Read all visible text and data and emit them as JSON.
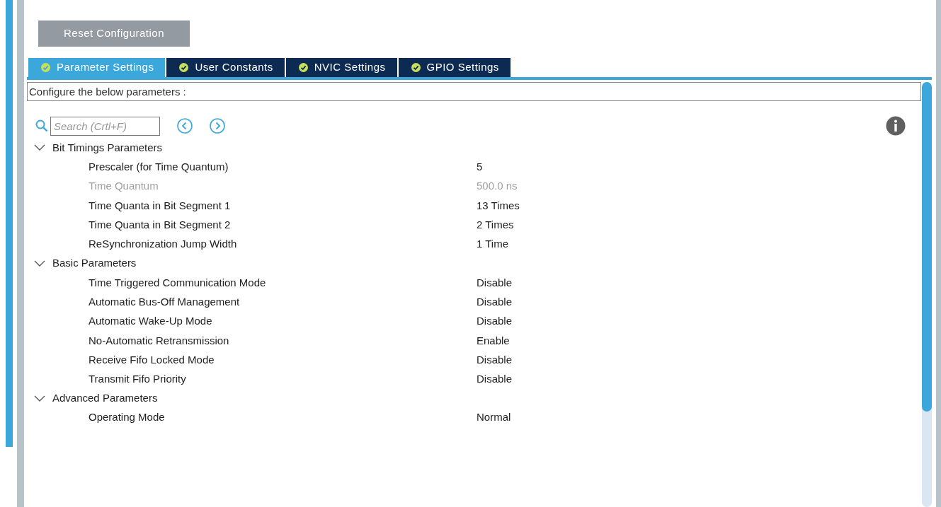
{
  "reset_button": "Reset Configuration",
  "tabs": [
    {
      "label": "Parameter Settings",
      "selected": true
    },
    {
      "label": "User Constants",
      "selected": false
    },
    {
      "label": "NVIC Settings",
      "selected": false
    },
    {
      "label": "GPIO Settings",
      "selected": false
    }
  ],
  "description": "Configure the below parameters :",
  "search": {
    "placeholder": "Search (Crtl+F)"
  },
  "groups": [
    {
      "title": "Bit Timings Parameters",
      "expanded": true,
      "params": [
        {
          "name": "Prescaler (for Time Quantum)",
          "value": "5",
          "disabled": false
        },
        {
          "name": "Time Quantum",
          "value": "500.0 ns",
          "disabled": true
        },
        {
          "name": "Time Quanta in Bit Segment 1",
          "value": "13 Times",
          "disabled": false
        },
        {
          "name": "Time Quanta in Bit Segment 2",
          "value": "2 Times",
          "disabled": false
        },
        {
          "name": "ReSynchronization Jump Width",
          "value": "1 Time",
          "disabled": false
        }
      ]
    },
    {
      "title": "Basic Parameters",
      "expanded": true,
      "params": [
        {
          "name": "Time Triggered Communication Mode",
          "value": "Disable",
          "disabled": false
        },
        {
          "name": "Automatic Bus-Off Management",
          "value": "Disable",
          "disabled": false
        },
        {
          "name": "Automatic Wake-Up Mode",
          "value": "Disable",
          "disabled": false
        },
        {
          "name": "No-Automatic Retransmission",
          "value": "Enable",
          "disabled": false
        },
        {
          "name": "Receive Fifo Locked Mode",
          "value": "Disable",
          "disabled": false
        },
        {
          "name": "Transmit Fifo Priority",
          "value": "Disable",
          "disabled": false
        }
      ]
    },
    {
      "title": "Advanced Parameters",
      "expanded": true,
      "params": [
        {
          "name": "Operating Mode",
          "value": "Normal",
          "disabled": false
        }
      ]
    }
  ]
}
